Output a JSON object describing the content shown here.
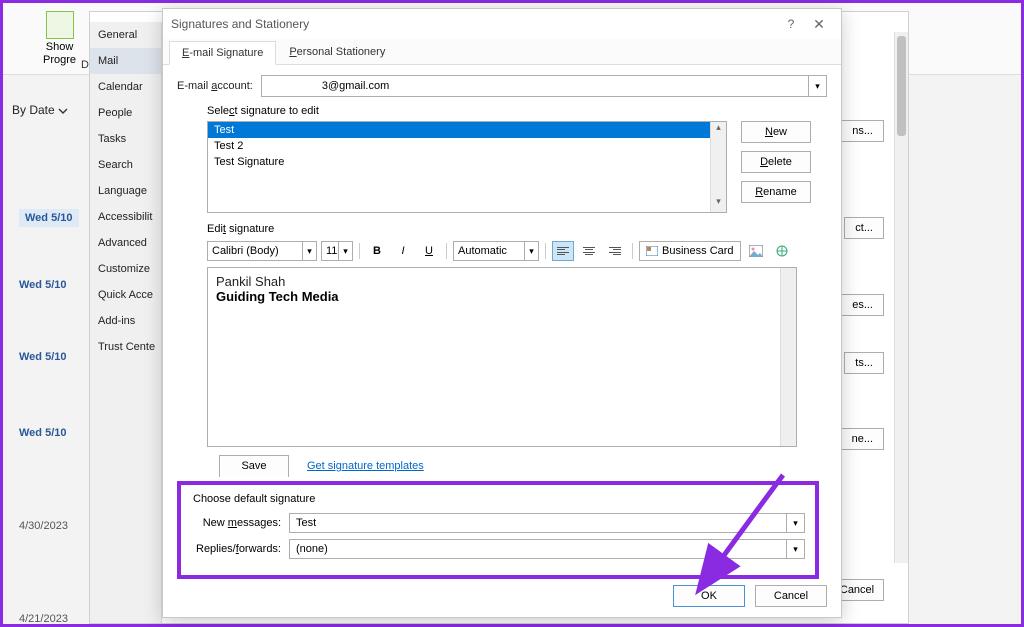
{
  "ribbon": {
    "show_progress": "Show\nProgre",
    "do_label": "Do"
  },
  "mail_list": {
    "by_date": "By Date",
    "dates": [
      "Wed 5/10",
      "Wed 5/10",
      "Wed 5/10",
      "Wed 5/10"
    ],
    "dates_gray": [
      "4/30/2023",
      "4/21/2023"
    ]
  },
  "options_sidebar": [
    "General",
    "Mail",
    "Calendar",
    "People",
    "Tasks",
    "Search",
    "Language",
    "Accessibilit",
    "Advanced",
    "Customize",
    "Quick Acce",
    "Add-ins",
    "Trust Cente"
  ],
  "options_side_buttons": [
    "ns...",
    "ct...",
    "es...",
    "ts...",
    "ne..."
  ],
  "options_cancel": "Cancel",
  "dialog": {
    "title": "Signatures and Stationery",
    "tabs": {
      "email_sig": "E-mail Signature",
      "personal": "Personal Stationery"
    },
    "acct_label": "E-mail account:",
    "acct_value": "3@gmail.com",
    "select_label": "Select signature to edit",
    "signatures": [
      "Test",
      "Test 2",
      "Test Signature"
    ],
    "btn_new": "New",
    "btn_delete": "Delete",
    "btn_rename": "Rename",
    "edit_label": "Edit signature",
    "font_name": "Calibri (Body)",
    "font_size": "11",
    "color_auto": "Automatic",
    "biz_card": "Business Card",
    "editor_line1": "Pankil Shah",
    "editor_line2": "Guiding Tech Media",
    "save": "Save",
    "templates_link": "Get signature templates",
    "default": {
      "header": "Choose default signature",
      "new_msg_label": "New messages:",
      "new_msg_value": "Test",
      "replies_label": "Replies/forwards:",
      "replies_value": "(none)"
    },
    "ok": "OK",
    "cancel": "Cancel"
  }
}
